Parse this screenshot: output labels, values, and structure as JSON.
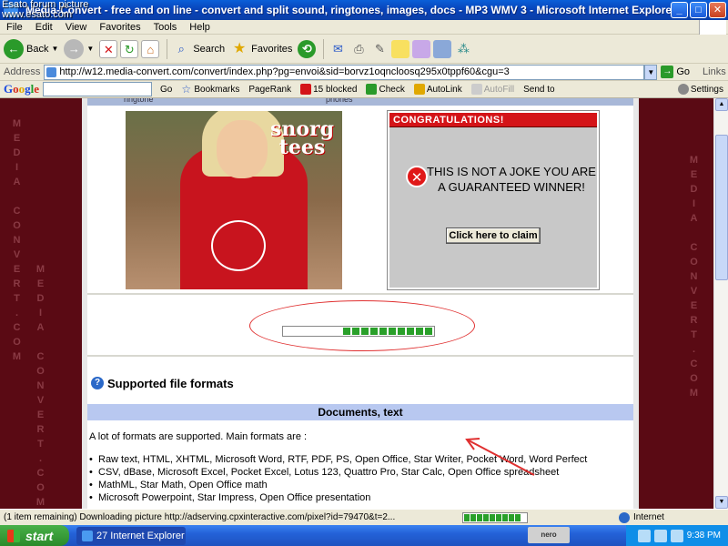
{
  "window": {
    "title": "Media-Convert - free and on line - convert and split sound, ringtones, images, docs - MP3 WMV 3 - Microsoft Internet Explorer",
    "overlay_credit_line1": "Esato forum picture",
    "overlay_credit_line2": "www.esato.com",
    "min": "_",
    "max": "□",
    "close": "✕"
  },
  "menu": [
    "File",
    "Edit",
    "View",
    "Favorites",
    "Tools",
    "Help"
  ],
  "toolbar": {
    "back": "Back",
    "search": "Search",
    "favorites": "Favorites"
  },
  "address": {
    "label": "Address",
    "url": "http://w12.media-convert.com/convert/index.php?pg=envoi&sid=borvz1oqncloosq295x0tppf60&cgu=3",
    "go": "Go",
    "links": "Links"
  },
  "google": {
    "go": "Go",
    "bookmarks": "Bookmarks",
    "pagerank": "PageRank",
    "blocked": "15 blocked",
    "check": "Check",
    "autolink": "AutoLink",
    "autofill": "AutoFill",
    "sendto": "Send to",
    "settings": "Settings"
  },
  "page": {
    "side_text": "MEDIA CONVERT .COM",
    "tab_left": "ringtone",
    "tab_right": "phones",
    "ad_brand": "snorg tees",
    "congrats_header": "CONGRATULATIONS!",
    "claim_message": "THIS IS NOT A JOKE YOU ARE A GUARANTEED WINNER!",
    "claim_button": "Click here to claim",
    "progress_fraction": 0.6,
    "supported_title": "Supported file formats",
    "docs_header": "Documents, text",
    "intro": "A lot of formats are supported. Main formats are :",
    "formats": [
      "Raw text, HTML, XHTML, Microsoft Word, RTF, PDF, PS, Open Office, Star Writer, Pocket Word, Word Perfect",
      "CSV, dBase, Microsoft Excel, Pocket Excel, Lotus 123, Quattro Pro, Star Calc, Open Office spreadsheet",
      "MathML, Star Math, Open Office math",
      "Microsoft Powerpoint, Star Impress, Open Office presentation"
    ]
  },
  "status": {
    "text": "(1 item remaining) Downloading picture http://adserving.cpxinteractive.com/pixel?id=79470&t=2...",
    "zone": "Internet"
  },
  "taskbar": {
    "start": "start",
    "task": "27 Internet Explorer",
    "nero": "nero SEARCH",
    "clock": "9:38 PM"
  },
  "colors": {
    "accent": "#0a5fd8",
    "ad_red": "#d41418",
    "progress_green": "#2aa02a",
    "page_maroon": "#5a0a14"
  }
}
